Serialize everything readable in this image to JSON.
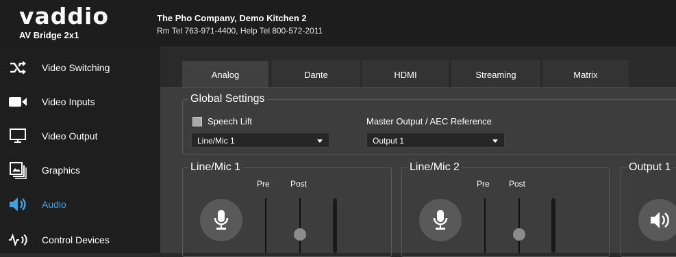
{
  "header": {
    "logo": "vaddio",
    "product": "AV Bridge 2x1",
    "company": "The Pho Company, Demo Kitchen 2",
    "phones": "Rm Tel 763-971-4400, Help Tel 800-572-2011"
  },
  "sidebar": {
    "items": [
      {
        "label": "Video Switching",
        "icon": "shuffle-icon"
      },
      {
        "label": "Video Inputs",
        "icon": "video-camera-icon"
      },
      {
        "label": "Video Output",
        "icon": "monitor-icon"
      },
      {
        "label": "Graphics",
        "icon": "image-stack-icon"
      },
      {
        "label": "Audio",
        "icon": "speaker-icon",
        "active": true
      },
      {
        "label": "Control Devices",
        "icon": "control-signal-icon"
      }
    ]
  },
  "tabs": [
    {
      "label": "Analog",
      "active": true
    },
    {
      "label": "Dante"
    },
    {
      "label": "HDMI"
    },
    {
      "label": "Streaming"
    },
    {
      "label": "Matrix"
    }
  ],
  "global_settings": {
    "title": "Global Settings",
    "speech_lift_label": "Speech Lift",
    "speech_lift_checked": false,
    "source_select": "Line/Mic 1",
    "master_output_label": "Master Output / AEC Reference",
    "master_output_select": "Output 1"
  },
  "channels": [
    {
      "title": "Line/Mic 1",
      "pre": "Pre",
      "post": "Post"
    },
    {
      "title": "Line/Mic 2",
      "pre": "Pre",
      "post": "Post"
    },
    {
      "title": "Output 1"
    }
  ],
  "colors": {
    "accent": "#3ba3e6",
    "sidebar_bg": "#1e1e1e",
    "panel_bg": "#3d3d3d"
  }
}
